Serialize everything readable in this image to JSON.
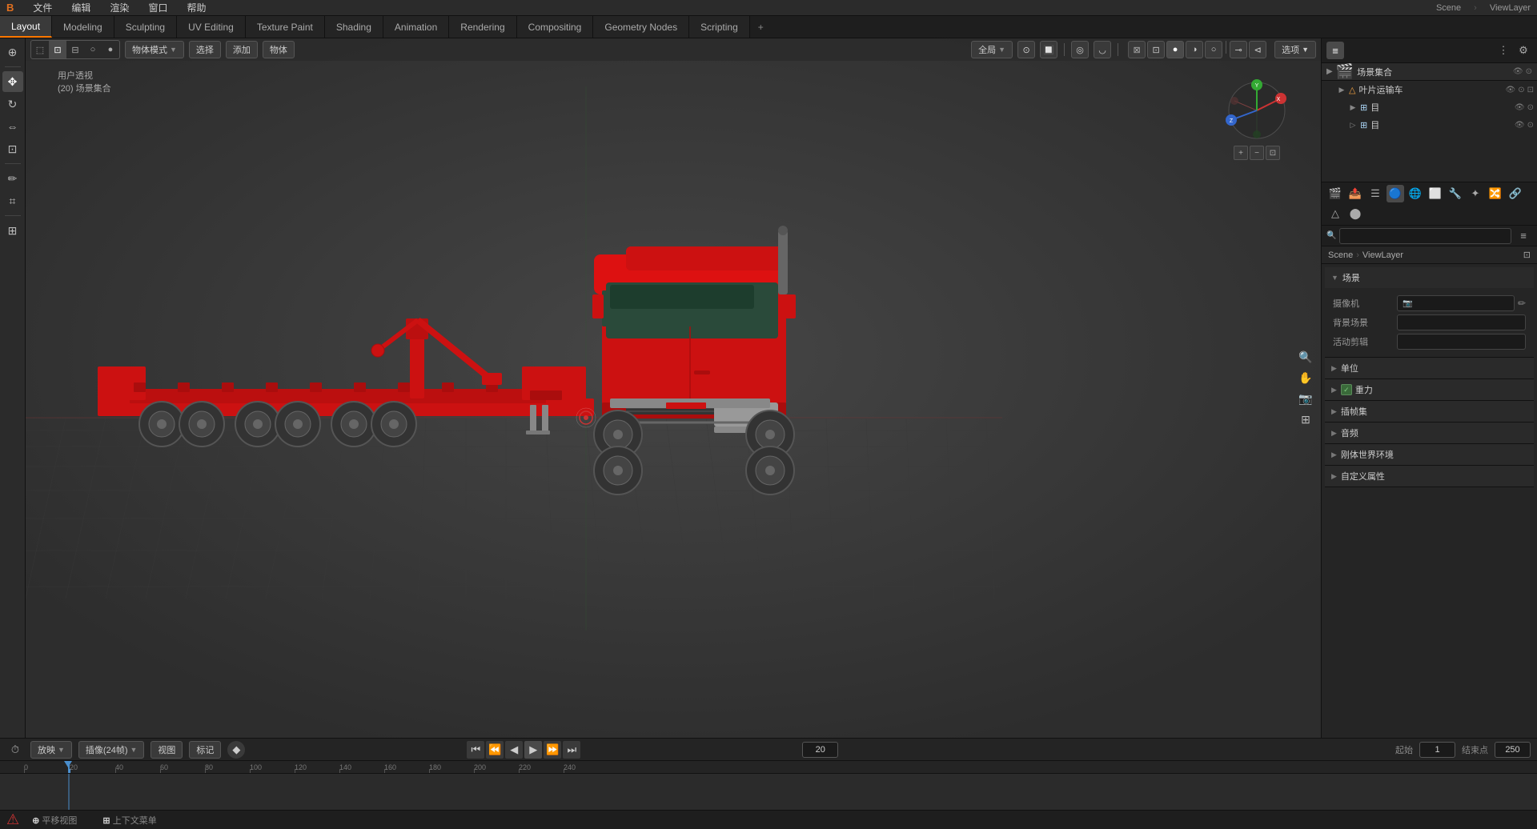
{
  "app": {
    "title": "Blender",
    "logo": "B"
  },
  "top_menu": {
    "items": [
      "文件",
      "编辑",
      "渲染",
      "窗口",
      "帮助"
    ]
  },
  "workspace_tabs": {
    "tabs": [
      "Layout",
      "Modeling",
      "Sculpting",
      "UV Editing",
      "Texture Paint",
      "Shading",
      "Animation",
      "Rendering",
      "Compositing",
      "Geometry Nodes",
      "Scripting"
    ],
    "active": "Layout",
    "add_label": "+"
  },
  "viewport": {
    "view_label": "用户透视",
    "scene_label": "(20) 场景集合",
    "mode_label": "物体模式",
    "global_label": "全局",
    "object_mode_btn": "物体模式",
    "selection_label": "选择",
    "add_label": "添加",
    "object_label": "物体"
  },
  "timeline": {
    "playback_label": "放映",
    "fps_label": "插像(24帧)",
    "view_label": "视图",
    "marker_label": "标记",
    "current_frame": "20",
    "start_label": "起始",
    "start_frame": "1",
    "end_label": "结束点",
    "end_frame": "250",
    "ruler_marks": [
      "0",
      "20",
      "40",
      "60",
      "80",
      "100",
      "120",
      "140",
      "160",
      "180",
      "200",
      "220",
      "240"
    ],
    "ruler_positions": [
      0,
      20,
      40,
      60,
      80,
      100,
      120,
      140,
      160,
      180,
      200,
      220,
      240
    ]
  },
  "right_panel": {
    "scene_label": "场景集合",
    "tree_items": [
      {
        "label": "叶片运输车",
        "icon": "▶",
        "indent": 1,
        "type": "mesh"
      },
      {
        "label": "目",
        "icon": "▶",
        "indent": 2,
        "type": "mesh"
      },
      {
        "label": "目",
        "icon": "▷",
        "indent": 2,
        "type": "mesh"
      }
    ],
    "scene_btn": "Scene",
    "viewlayer_btn": "ViewLayer",
    "search_placeholder": "",
    "filter_placeholder": "",
    "props": {
      "section_label": "场景",
      "camera_label": "摄像机",
      "bg_scene_label": "背景场景",
      "active_clip_label": "活动剪辑",
      "unit_label": "单位",
      "gravity_label": "重力",
      "gravity_checked": true,
      "keying_label": "插帧集",
      "audio_label": "音频",
      "rigid_world_label": "刚体世界环境",
      "custom_props_label": "自定义属性"
    }
  },
  "status_bar": {
    "items": [
      "平移视图",
      "上下文菜单"
    ]
  },
  "colors": {
    "accent_orange": "#ff7700",
    "truck_red": "#cc1111",
    "bg_dark": "#393939",
    "bg_medium": "#2b2b2b",
    "bg_light": "#3a3a3a",
    "axis_red": "#cc3333",
    "axis_green": "#33aa33",
    "axis_blue": "#3366cc",
    "selected_blue": "#1d4070",
    "playhead_blue": "#4a7aaa"
  },
  "icons": {
    "expand_right": "▶",
    "expand_down": "▼",
    "eye": "👁",
    "camera": "📷",
    "render": "🎬",
    "move": "✥",
    "rotate": "↻",
    "scale": "⇔",
    "cursor": "⊕",
    "plus": "+",
    "minus": "−",
    "search": "🔍",
    "filter": "≡",
    "pin": "📌"
  }
}
